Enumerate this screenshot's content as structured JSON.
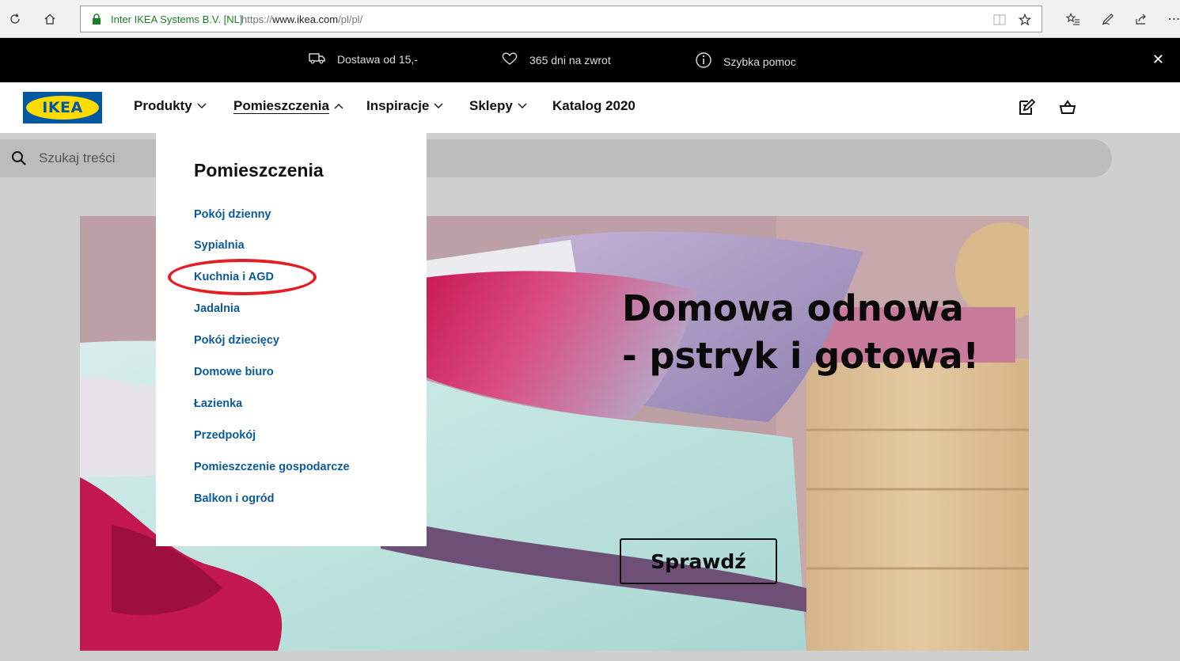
{
  "browser": {
    "cert": "Inter IKEA Systems B.V. [NL]",
    "url_prefix": "https://",
    "url_domain": "www.ikea.com",
    "url_path": "/pl/pl/"
  },
  "promo": {
    "delivery": "Dostawa od 15,-",
    "returns": "365 dni na zwrot",
    "help": "Szybka pomoc"
  },
  "logo": "IKEA",
  "nav": {
    "produkty": "Produkty",
    "pomieszczenia": "Pomieszczenia",
    "inspiracje": "Inspiracje",
    "sklepy": "Sklepy",
    "katalog": "Katalog 2020"
  },
  "search": {
    "placeholder": "Szukaj treści"
  },
  "dropdown": {
    "title": "Pomieszczenia",
    "items": [
      "Pokój dzienny",
      "Sypialnia",
      "Kuchnia i AGD",
      "Jadalnia",
      "Pokój dziecięcy",
      "Domowe biuro",
      "Łazienka",
      "Przedpokój",
      "Pomieszczenie gospodarcze",
      "Balkon i ogród"
    ]
  },
  "hero": {
    "line1": "Domowa odnowa",
    "line2": "- pstryk i gotowa!",
    "button": "Sprawdź"
  },
  "colors": {
    "ikea_blue": "#0058a3",
    "ikea_yellow": "#ffdb00",
    "link_blue": "#0b5a98",
    "annotation_red": "#e51d24"
  }
}
